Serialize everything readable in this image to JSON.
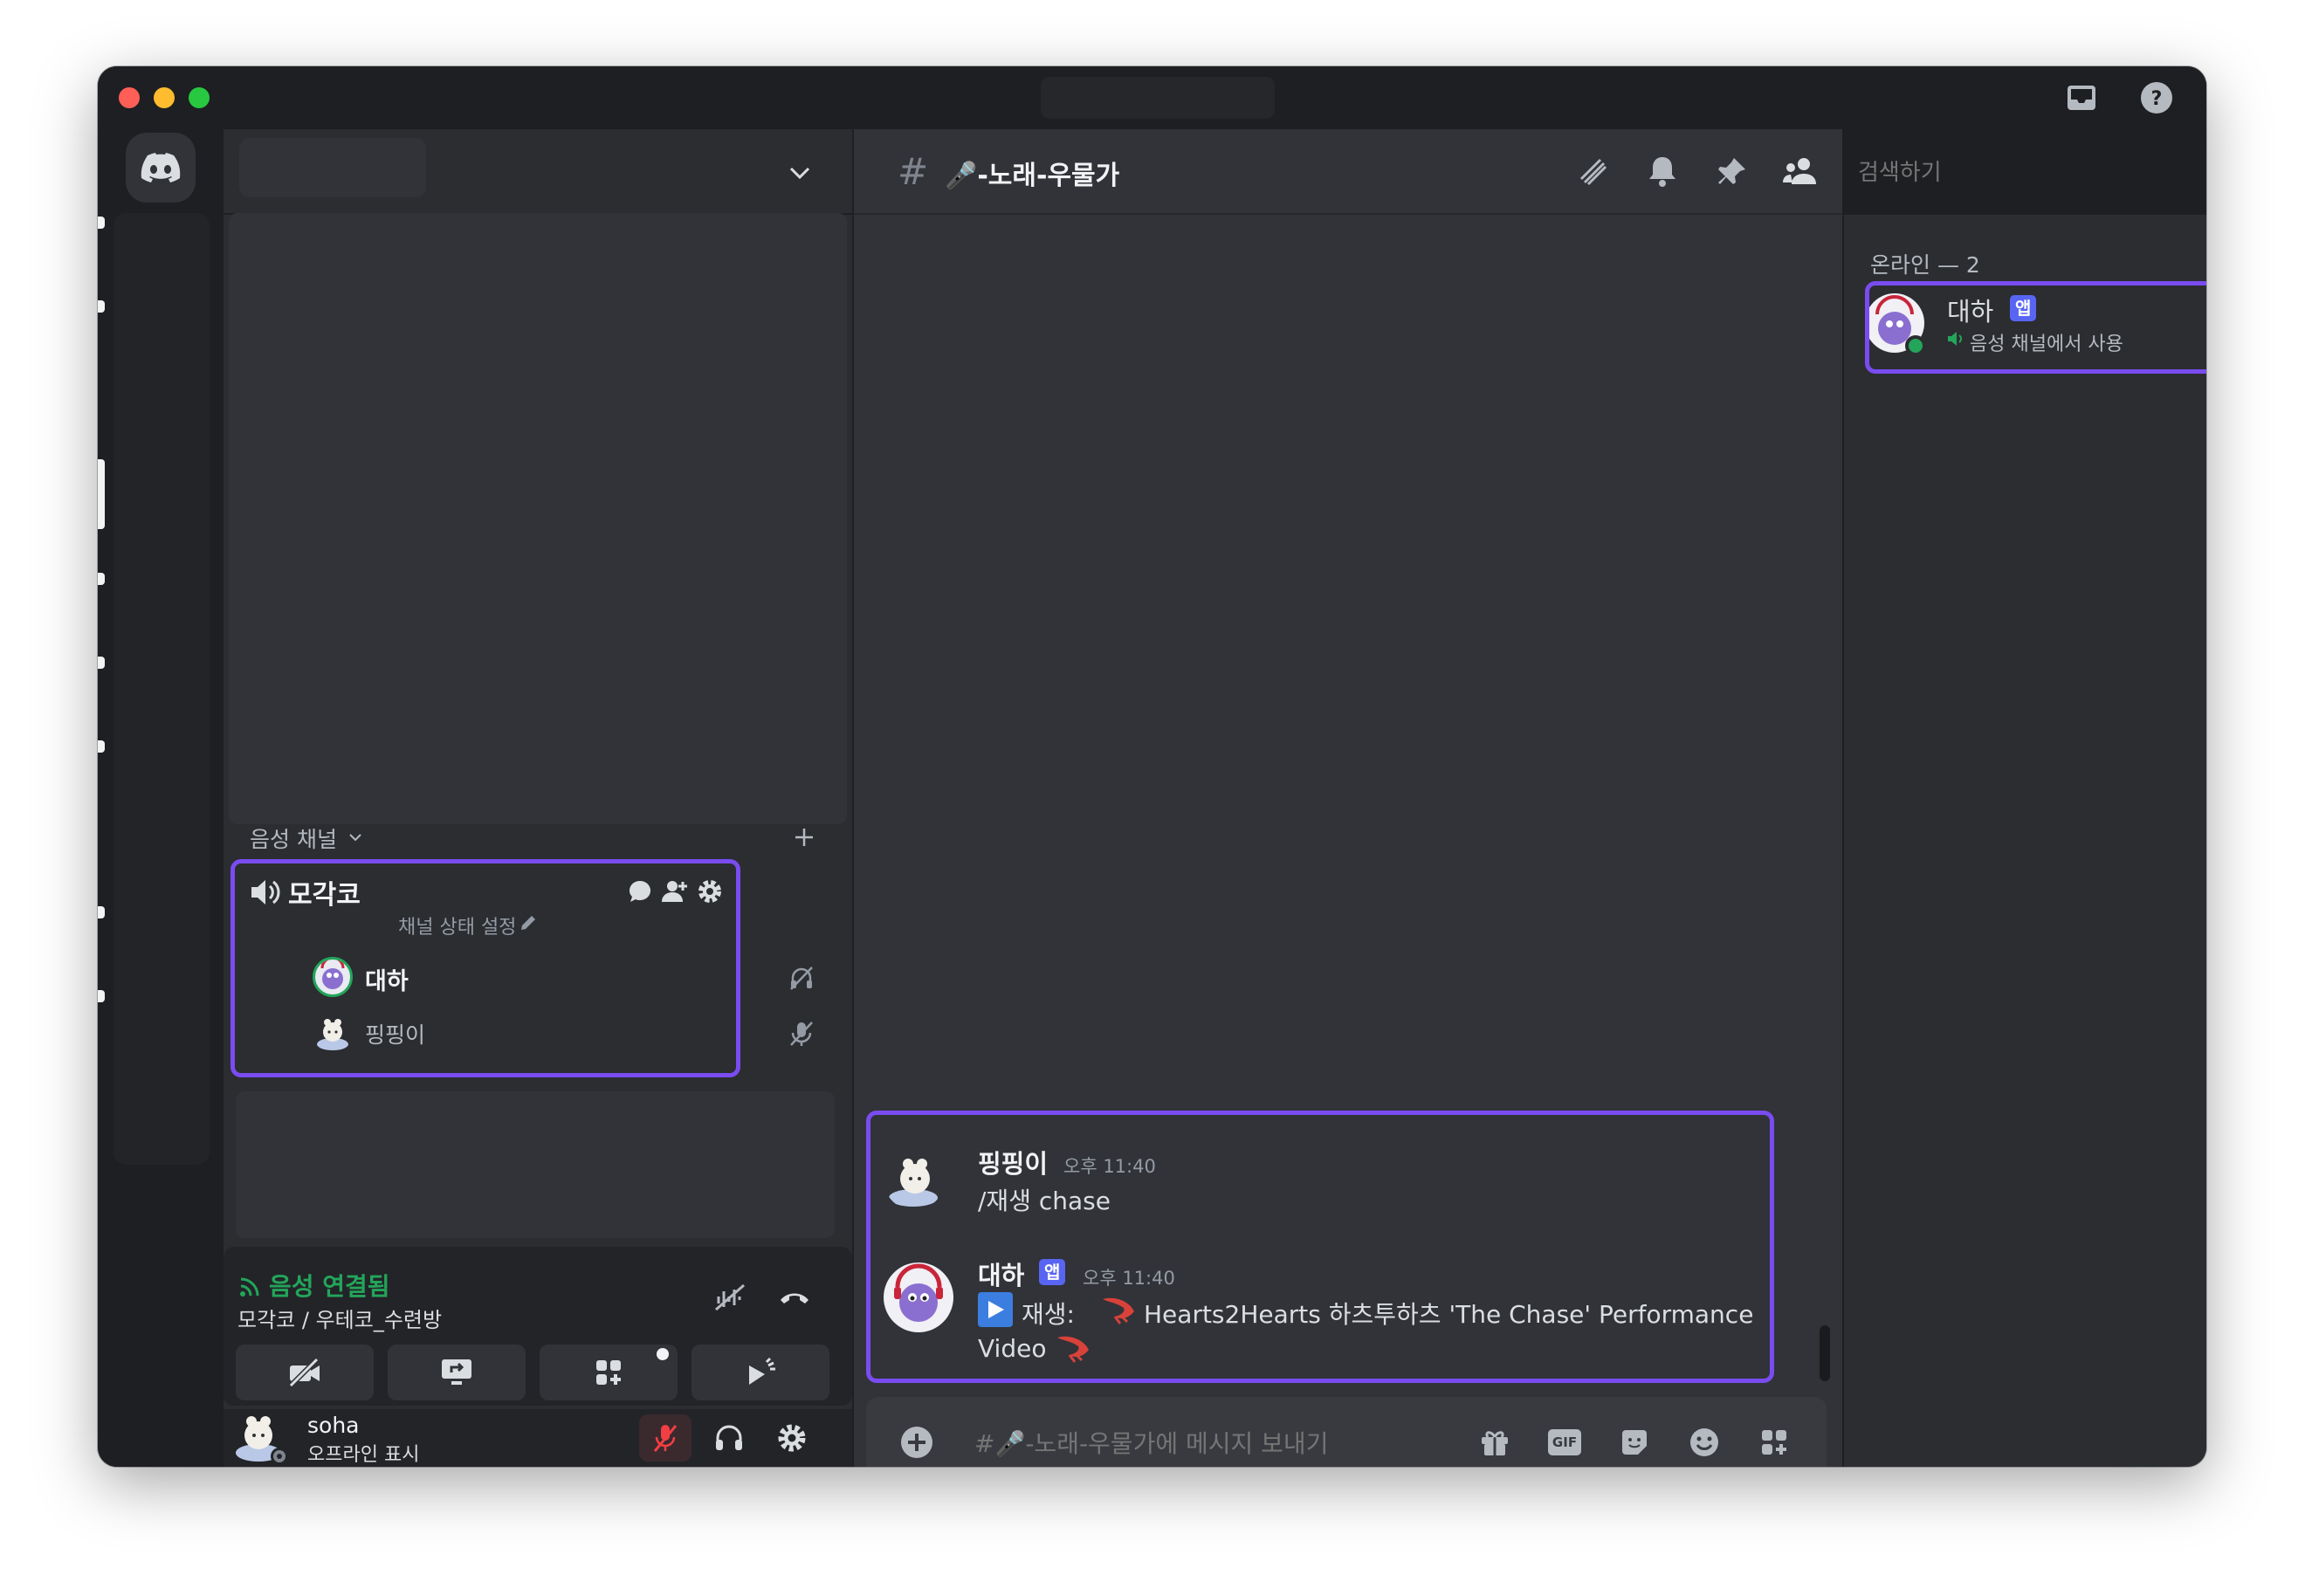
{
  "channel_header": {
    "hash": "#",
    "name": "🎤-노래-우물가",
    "search_placeholder": "검색하기"
  },
  "sidebar": {
    "voice_category": "음성 채널",
    "voice_channel": {
      "name": "모각코",
      "status_hint": "채널 상태 설정",
      "members": [
        {
          "name": "대하"
        },
        {
          "name": "핑핑이"
        }
      ]
    }
  },
  "voice_panel": {
    "status": "음성 연결됨",
    "location": "모각코 / 우테코_수련방"
  },
  "user_panel": {
    "username": "soha",
    "status": "오프라인 표시"
  },
  "messages": [
    {
      "author": "핑핑이",
      "time": "오후 11:40",
      "text": "/재생 chase"
    },
    {
      "author": "대하",
      "badge": "앱",
      "time": "오후 11:40",
      "prefix": "재생:",
      "text_line1": "Hearts2Hearts 하츠투하츠 'The Chase' Performance",
      "text_line2": "Video"
    }
  ],
  "composer": {
    "placeholder": "#🎤-노래-우물가에 메시지 보내기",
    "gif_label": "GIF"
  },
  "members_panel": {
    "section": "온라인 — 2",
    "members": [
      {
        "name": "대하",
        "badge": "앱",
        "activity": "음성 채널에서 사용"
      }
    ]
  },
  "colors": {
    "accent": "#5865f2",
    "online": "#23a55a",
    "highlight": "#7a4cf0",
    "connected": "#23a55a",
    "muted": "#f23f43"
  }
}
